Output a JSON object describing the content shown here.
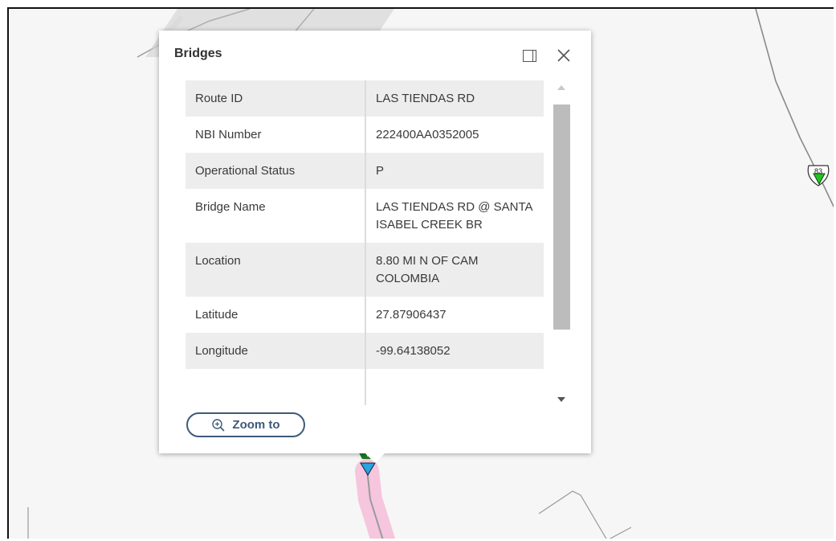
{
  "popup": {
    "title": "Bridges",
    "dock_icon": "dock-icon",
    "close_icon": "close-icon",
    "zoom_label": "Zoom to",
    "zoom_icon": "zoom-in-icon"
  },
  "attributes": [
    {
      "key": "Route ID",
      "value": "LAS TIENDAS RD"
    },
    {
      "key": "NBI Number",
      "value": "222400AA0352005"
    },
    {
      "key": "Operational Status",
      "value": "P"
    },
    {
      "key": "Bridge Name",
      "value": "LAS TIENDAS RD @ SANTA ISABEL CREEK BR"
    },
    {
      "key": "Location",
      "value": "8.80 MI N OF CAM COLOMBIA"
    },
    {
      "key": "Latitude",
      "value": "27.87906437"
    },
    {
      "key": "Longitude",
      "value": "-99.64138052"
    },
    {
      "key": "",
      "value": ""
    }
  ],
  "map": {
    "shield_label": "83",
    "highlight_color": "#f5c6dd",
    "road_color": "#8a8a8a",
    "marker_blue": "#2aa3e0",
    "marker_green": "#22c422"
  }
}
